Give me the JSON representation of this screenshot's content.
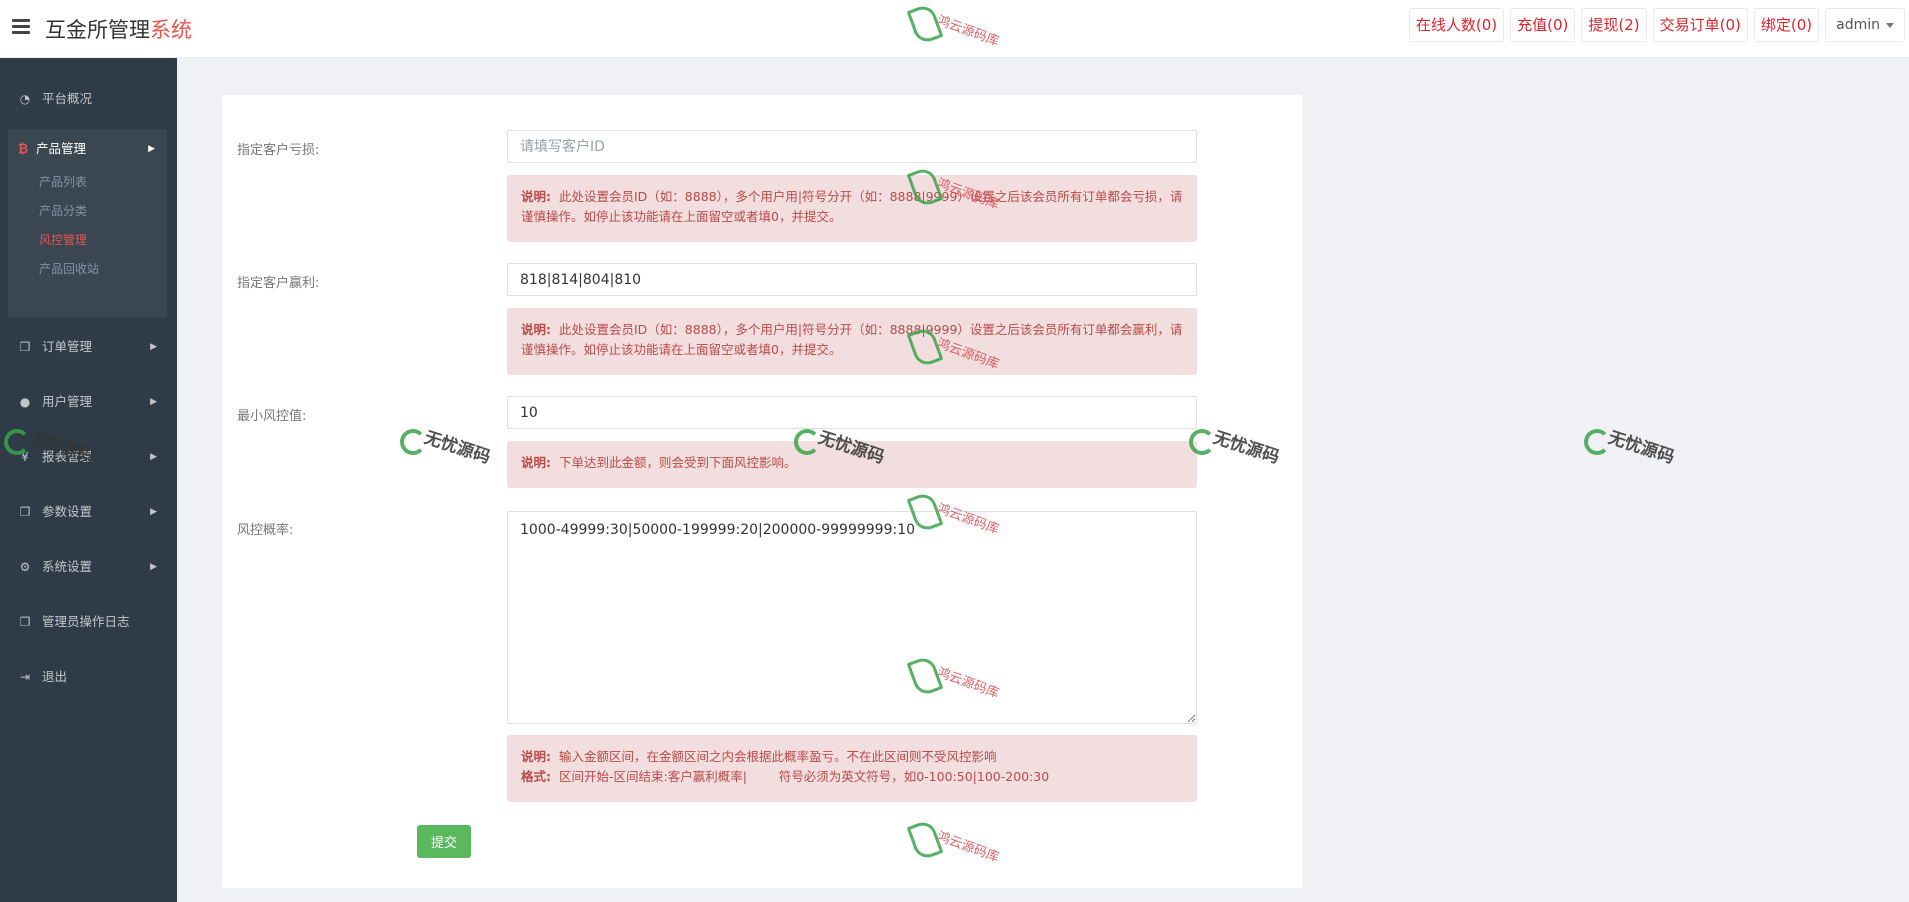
{
  "header": {
    "brand_main": "互金所管理",
    "brand_accent": "系统",
    "nav": [
      {
        "label": "在线人数(0)"
      },
      {
        "label": "充值(0)"
      },
      {
        "label": "提现(2)"
      },
      {
        "label": "交易订单(0)"
      },
      {
        "label": "绑定(0)"
      }
    ],
    "user": "admin"
  },
  "sidebar": {
    "items": [
      {
        "label": "平台概况",
        "icon": "dashboard-icon"
      },
      {
        "label": "产品管理",
        "icon": "bitcoin-icon"
      },
      {
        "label": "订单管理",
        "icon": "copy-icon"
      },
      {
        "label": "用户管理",
        "icon": "user-icon"
      },
      {
        "label": "报表管理",
        "icon": "yen-icon"
      },
      {
        "label": "参数设置",
        "icon": "copy-icon"
      },
      {
        "label": "系统设置",
        "icon": "cogs-icon"
      },
      {
        "label": "管理员操作日志",
        "icon": "copy-icon"
      },
      {
        "label": "退出",
        "icon": "sign-out-icon"
      }
    ],
    "sub_items": [
      {
        "label": "产品列表"
      },
      {
        "label": "产品分类"
      },
      {
        "label": "风控管理"
      },
      {
        "label": "产品回收站"
      }
    ]
  },
  "form": {
    "loss_label": "指定客户亏损:",
    "loss_placeholder": "请填写客户ID",
    "loss_value": "",
    "loss_note_title": "说明:",
    "loss_note": "此处设置会员ID（如：8888），多个用户用|符号分开（如：8888|9999）设置之后该会员所有订单都会亏损，请谨慎操作。如停止该功能请在上面留空或者填0，并提交。",
    "win_label": "指定客户赢利:",
    "win_value": "818|814|804|810",
    "win_note_title": "说明:",
    "win_note": "此处设置会员ID（如：8888），多个用户用|符号分开（如：8888|9999）设置之后该会员所有订单都会赢利，请谨慎操作。如停止该功能请在上面留空或者填0，并提交。",
    "min_label": "最小风控值:",
    "min_value": "10",
    "min_note_title": "说明:",
    "min_note": "下单达到此金额，则会受到下面风控影响。",
    "rate_label": "风控概率:",
    "rate_value": "1000-49999:30|50000-199999:20|200000-99999999:10",
    "rate_note_title": "说明:",
    "rate_note": "输入金额区间，在金额区间之内会根据此概率盈亏。不在此区间则不受风控影响",
    "rate_format_title": "格式:",
    "rate_format": "区间开始-区间结束:客户赢利概率|        符号必须为英文符号，如0-100:50|100-200:30",
    "submit_label": "提交"
  },
  "watermark": {
    "text_a": "鸿云源码库",
    "text_b": "无忧源码"
  },
  "colors": {
    "accent": "#e6544b",
    "sidebar_bg": "#2f3c47",
    "note_bg": "#f2dede",
    "note_text": "#b94a48",
    "submit_bg": "#5cb85c"
  }
}
